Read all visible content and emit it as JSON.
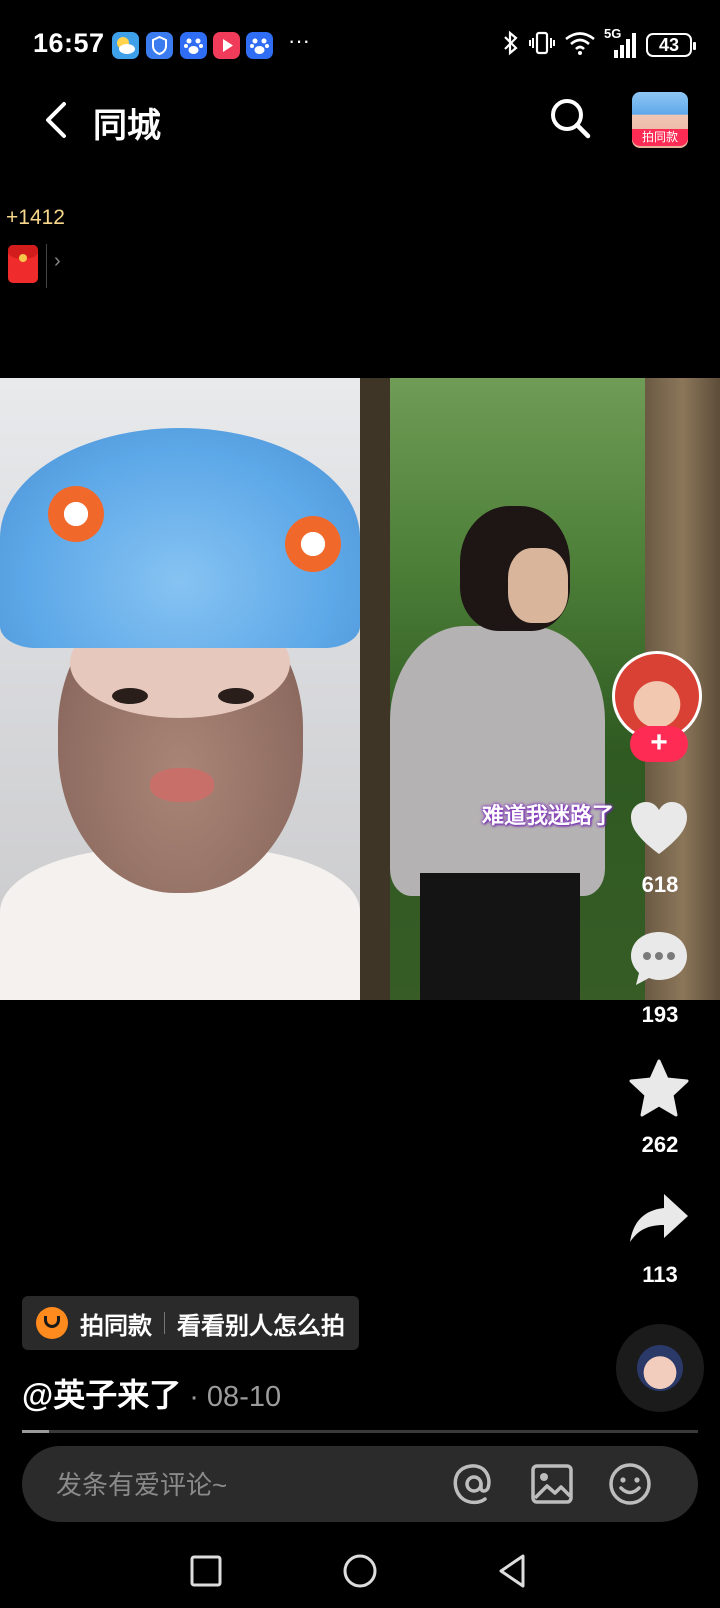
{
  "status_bar": {
    "time": "16:57",
    "overflow_dots": "···",
    "network": "5G",
    "battery": "43",
    "app_icons": [
      "weather-icon",
      "shield-app-icon",
      "baidu-icon",
      "video-app-icon",
      "baidu-icon"
    ]
  },
  "header": {
    "title": "同城",
    "same_style_thumb_label": "拍同款"
  },
  "reward": {
    "coins": "+1412",
    "arrow": "›"
  },
  "video": {
    "caption": "难道我迷路了"
  },
  "rail": {
    "likes": "618",
    "comments": "193",
    "favorites": "262",
    "shares": "113",
    "follow_symbol": "+"
  },
  "info": {
    "chip_primary": "拍同款",
    "chip_secondary": "看看别人怎么拍",
    "author": "@英子来了",
    "date": "· 08-10",
    "progress": 0.04
  },
  "comment_bar": {
    "placeholder": "发条有爱评论~"
  },
  "colors": {
    "accent": "#fe2c55",
    "background": "#000000",
    "coin": "#f6d78b"
  }
}
